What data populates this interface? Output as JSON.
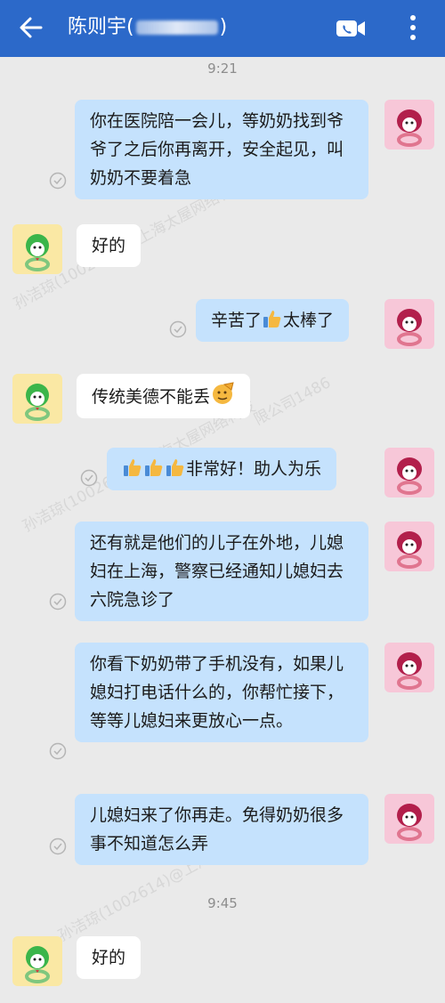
{
  "header": {
    "title_prefix": "陈则宇(",
    "title_suffix": ")",
    "back_icon": "arrow-left-icon",
    "video_icon": "video-call-icon",
    "more_icon": "more-vertical-icon"
  },
  "timestamps": [
    "9:21",
    "9:45"
  ],
  "messages": [
    {
      "side": "out",
      "text": "你在医院陪一会儿，等奶奶找到爷爷了之后你再离开，安全起见，叫奶奶不要着急"
    },
    {
      "side": "in",
      "text": "好的"
    },
    {
      "side": "out",
      "text_before": "辛苦了",
      "emoji": "thumbs-up",
      "text_after": "太棒了"
    },
    {
      "side": "in",
      "text": "传统美德不能丢",
      "emoji": "salute-face"
    },
    {
      "side": "out",
      "emojis": [
        "thumbs-up",
        "thumbs-up",
        "thumbs-up"
      ],
      "text": "非常好！助人为乐"
    },
    {
      "side": "out",
      "text": "还有就是他们的儿子在外地，儿媳妇在上海，警察已经通知儿媳妇去六院急诊了"
    },
    {
      "side": "out",
      "text": "你看下奶奶带了手机没有，如果儿媳妇打电话什么的，你帮忙接下，等等儿媳妇来更放心一点。"
    },
    {
      "side": "out",
      "text": "儿媳妇来了你再走。免得奶奶很多事不知道怎么弄"
    },
    {
      "side": "in",
      "text": "好的"
    }
  ],
  "watermark": {
    "lines": [
      "孙洁琼(1002614)@上海太屋网络科技",
      "限公司1486",
      "孙洁琼(1002614)@上海太屋网络科技"
    ]
  },
  "colors": {
    "header": "#2c69c9",
    "background": "#eaeaea",
    "outgoing_bubble": "#c5e2fd",
    "incoming_bubble": "#ffffff"
  }
}
